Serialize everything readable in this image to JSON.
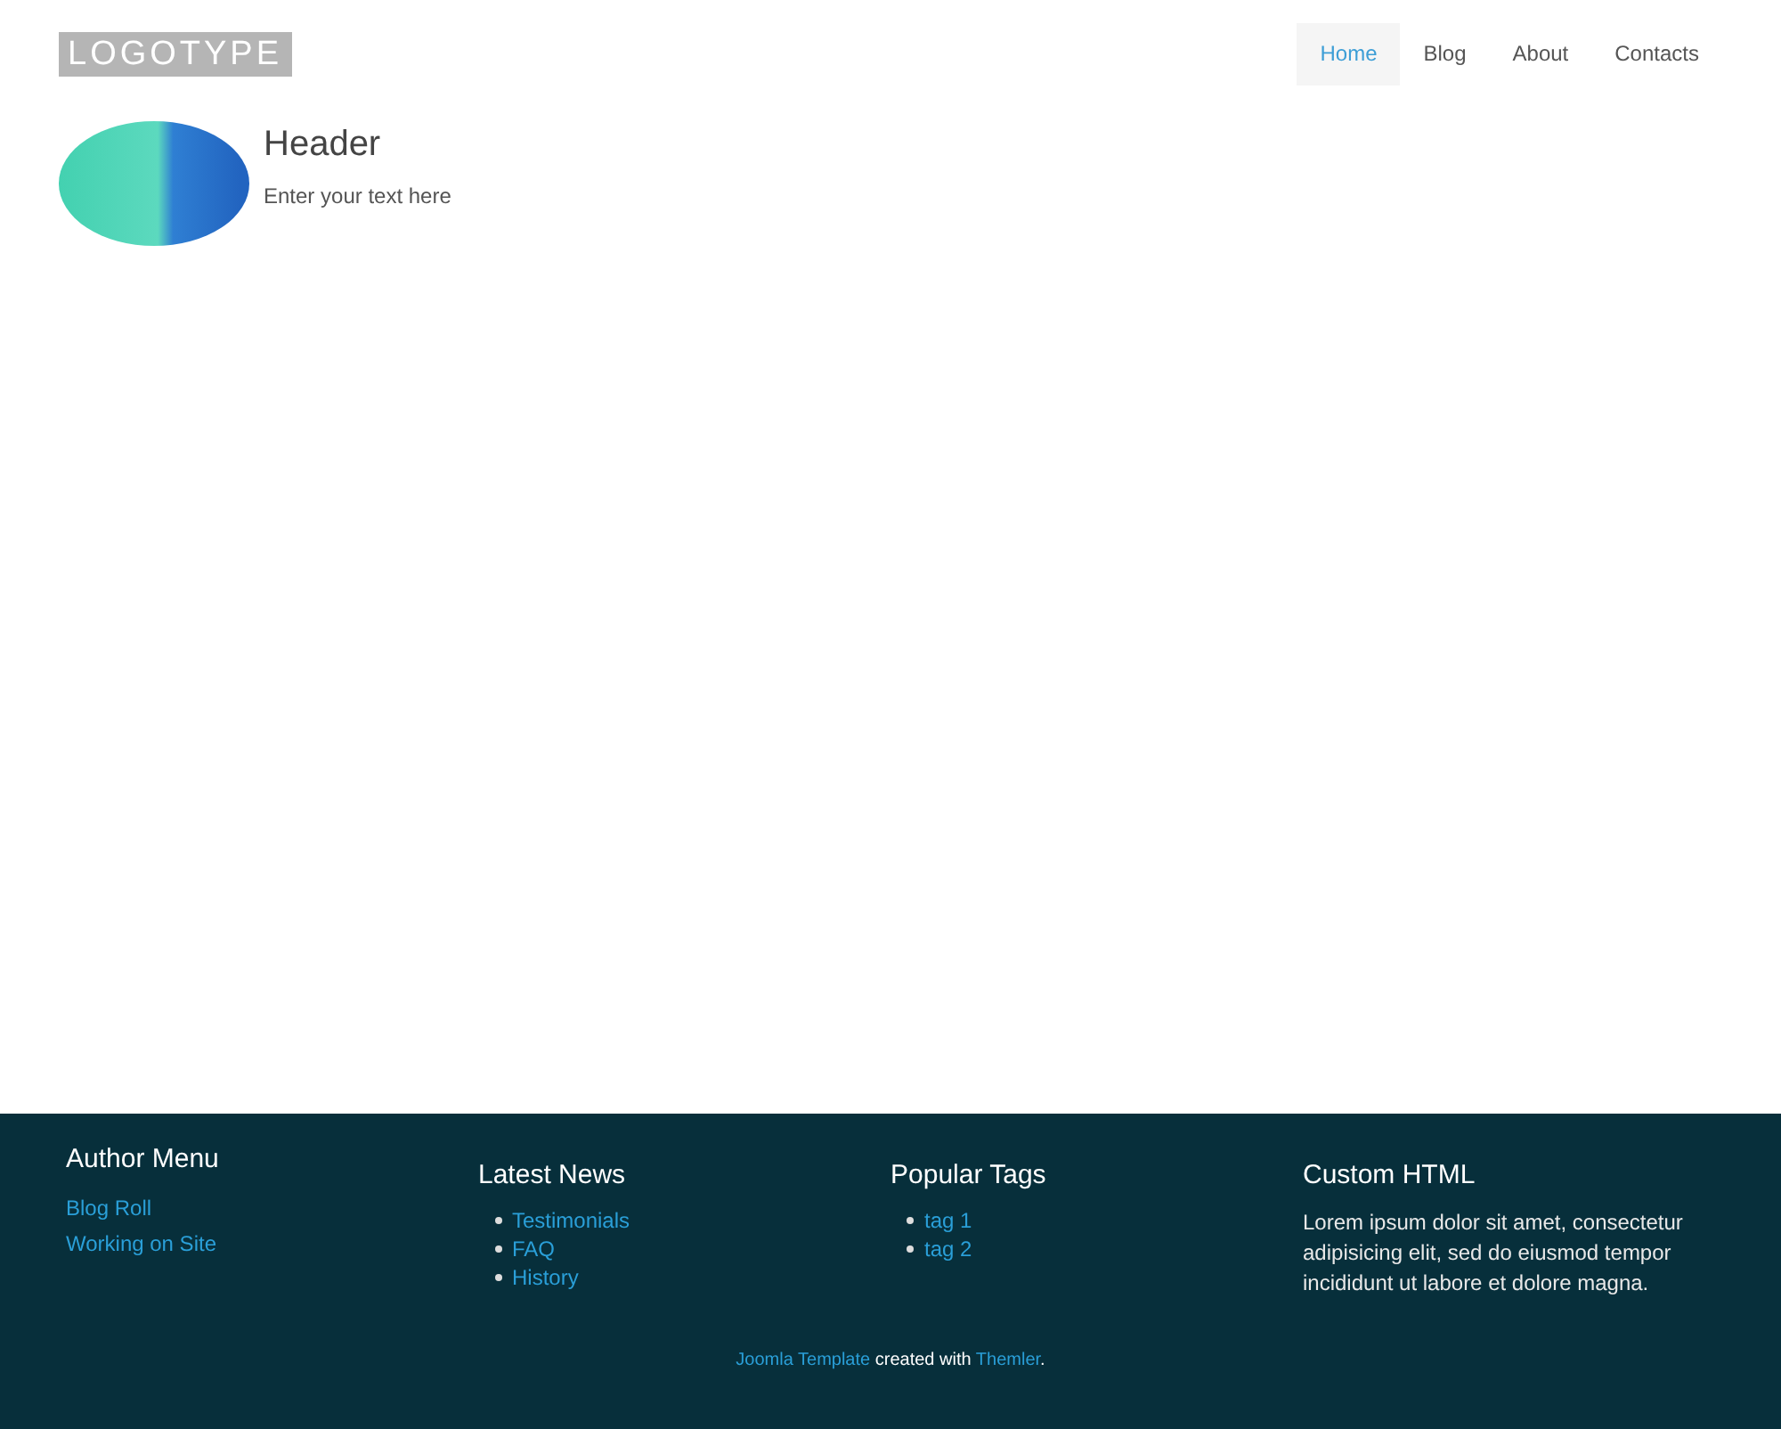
{
  "logo": "LOGOTYPE",
  "nav": [
    {
      "label": "Home",
      "selected": true
    },
    {
      "label": "Blog",
      "selected": false
    },
    {
      "label": "About",
      "selected": false
    },
    {
      "label": "Contacts",
      "selected": false
    }
  ],
  "hero": {
    "title": "Header",
    "text": "Enter your text here"
  },
  "footer": {
    "columns": [
      {
        "kind": "links",
        "title": "Author Menu",
        "items": [
          "Blog Roll",
          "Working on Site"
        ]
      },
      {
        "kind": "bullets",
        "title": "Latest News",
        "items": [
          "Testimonials",
          "FAQ",
          "History"
        ]
      },
      {
        "kind": "bullets",
        "title": "Popular Tags",
        "items": [
          "tag 1",
          "tag 2"
        ]
      },
      {
        "kind": "text",
        "title": "Custom HTML",
        "text": "Lorem ipsum dolor sit amet, consectetur adipisicing elit, sed do eiusmod tempor incididunt ut labore et dolore magna."
      }
    ],
    "credit": {
      "link_1": "Joomla Template",
      "middle": "created with",
      "link_2": "Themler",
      "end": "."
    }
  }
}
